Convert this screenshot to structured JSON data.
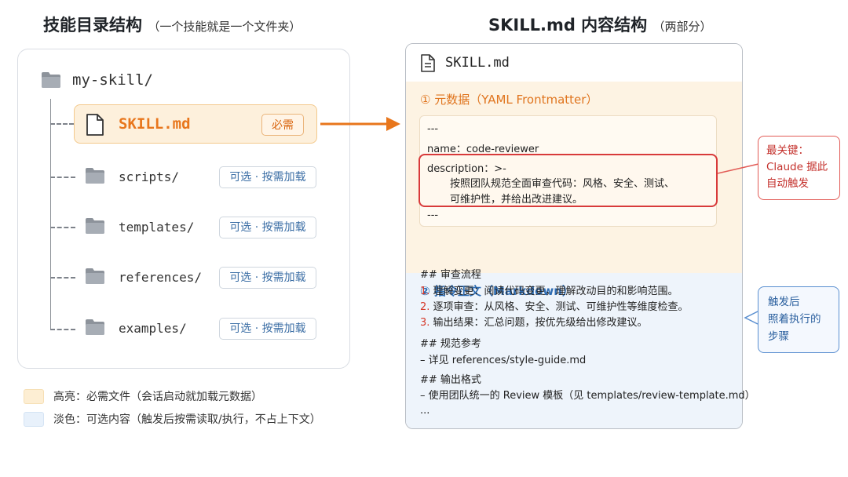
{
  "left": {
    "title": "技能目录结构",
    "subtitle": "（一个技能就是一个文件夹）",
    "root_folder": "my-skill/",
    "skill_file": {
      "name": "SKILL.md",
      "badge": "必需"
    },
    "entries": [
      {
        "name": "scripts/",
        "badge": "可选 · 按需加载"
      },
      {
        "name": "templates/",
        "badge": "可选 · 按需加载"
      },
      {
        "name": "references/",
        "badge": "可选 · 按需加载"
      },
      {
        "name": "examples/",
        "badge": "可选 · 按需加载"
      }
    ]
  },
  "legend": [
    {
      "color": "#fdeed3",
      "text": "高亮：必需文件（会话启动就加载元数据）"
    },
    {
      "color": "#e8f1fb",
      "text": "淡色：可选内容（触发后按需读取/执行，不占上下文）"
    }
  ],
  "right": {
    "title": "SKILL.md 内容结构",
    "subtitle": "（两部分）",
    "card_title": "SKILL.md",
    "meta": {
      "heading": "① 元数据（YAML Frontmatter）",
      "lines": {
        "sep_top": "---",
        "name": "name：code-reviewer",
        "desc_key": "description：>-",
        "desc_1": "按照团队规范全面审查代码：风格、安全、测试、",
        "desc_2": "可维护性，并给出改进建议。",
        "sep_bottom": "---"
      }
    },
    "body": {
      "heading": "② 指令正文（Markdown）",
      "h1": "##  审查流程",
      "steps": [
        {
          "num": "1.",
          "text": "理解变更：阅读代码变更，理解改动目的和影响范围。"
        },
        {
          "num": "2.",
          "text": "逐项审查：从风格、安全、测试、可维护性等维度检查。"
        },
        {
          "num": "3.",
          "text": "输出结果：汇总问题，按优先级给出修改建议。"
        }
      ],
      "h2": "##  规范参考",
      "ref": "–  详见  references/style-guide.md",
      "h3": "##  输出格式",
      "fmt": "–  使用团队统一的 Review 模板（见 templates/review-template.md）",
      "ellipsis": "..."
    }
  },
  "callouts": {
    "red": [
      "最关键：",
      "Claude 据此",
      "自动触发"
    ],
    "blue": [
      "触发后",
      "照着执行的",
      "步骤"
    ]
  },
  "colors": {
    "accent_orange": "#e8761c",
    "accent_red": "#d83a3a",
    "accent_blue": "#2f6db3"
  }
}
